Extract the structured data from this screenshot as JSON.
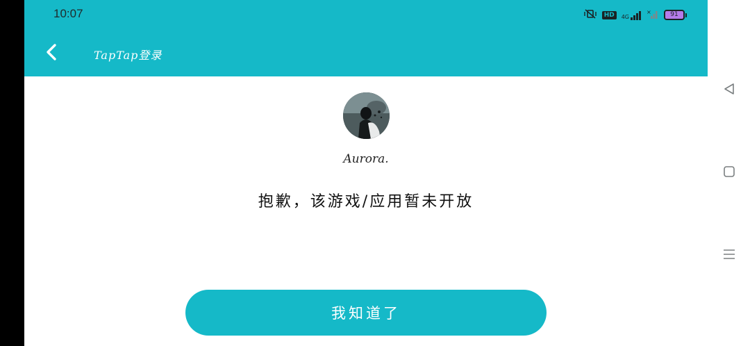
{
  "status_bar": {
    "time": "10:07",
    "hd_label": "HD",
    "network_label": "4G",
    "battery_level": "91"
  },
  "header": {
    "title": "TapTap登录"
  },
  "profile": {
    "username": "Aurora."
  },
  "main": {
    "message": "抱歉，该游戏/应用暂未开放",
    "confirm_button_label": "我知道了"
  },
  "colors": {
    "accent": "#15b9c8",
    "battery": "#b57be8"
  },
  "icons": {
    "back": "chevron-left-icon",
    "nav_back": "triangle-back-icon",
    "nav_home": "square-home-icon",
    "nav_menu": "menu-lines-icon"
  }
}
